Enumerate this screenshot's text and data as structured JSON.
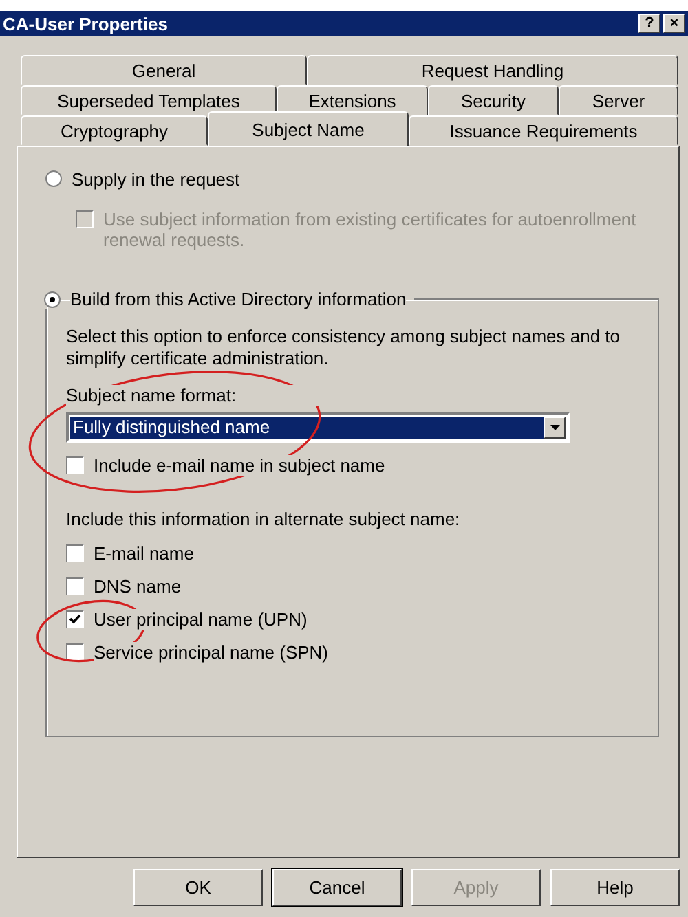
{
  "window": {
    "title": "CA-User Properties",
    "help_glyph": "?",
    "close_glyph": "×"
  },
  "tabs": [
    [
      {
        "label": "General",
        "selected": false
      },
      {
        "label": "Request Handling",
        "selected": false
      }
    ],
    [
      {
        "label": "Superseded Templates",
        "selected": false
      },
      {
        "label": "Extensions",
        "selected": false
      },
      {
        "label": "Security",
        "selected": false
      },
      {
        "label": "Server",
        "selected": false
      }
    ],
    [
      {
        "label": "Cryptography",
        "selected": false
      },
      {
        "label": "Subject Name",
        "selected": true
      },
      {
        "label": "Issuance Requirements",
        "selected": false
      }
    ]
  ],
  "supply_option": {
    "label": "Supply in the request",
    "selected": false
  },
  "use_existing": {
    "label": "Use subject information from existing certificates for autoenrollment renewal requests.",
    "checked": false,
    "disabled": true
  },
  "build_option": {
    "label": "Build from this Active Directory information",
    "selected": true
  },
  "description": "Select this option to enforce consistency among subject names and to simplify certificate administration.",
  "format_label": "Subject name format:",
  "format_value": "Fully distinguished name",
  "include_email": {
    "label": "Include e-mail name in subject name",
    "checked": false
  },
  "alt_label": "Include this information in alternate subject name:",
  "alt_options": [
    {
      "label": "E-mail name",
      "checked": false
    },
    {
      "label": "DNS name",
      "checked": false
    },
    {
      "label": "User principal name (UPN)",
      "checked": true
    },
    {
      "label": "Service principal name (SPN)",
      "checked": false
    }
  ],
  "buttons": [
    {
      "label": "OK",
      "disabled": false,
      "default": false
    },
    {
      "label": "Cancel",
      "disabled": false,
      "default": true
    },
    {
      "label": "Apply",
      "disabled": true,
      "default": false
    },
    {
      "label": "Help",
      "disabled": false,
      "default": false
    }
  ],
  "annotations": [
    {
      "kind": "ellipse"
    },
    {
      "kind": "ellipse"
    }
  ]
}
